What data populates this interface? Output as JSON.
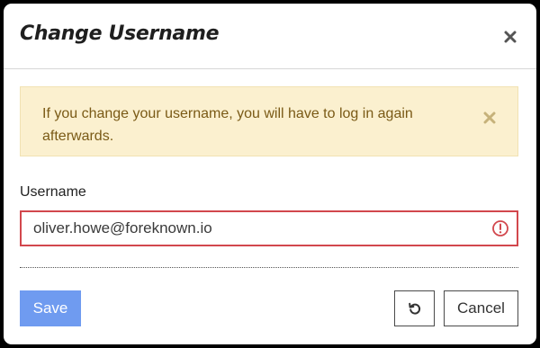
{
  "dialog": {
    "title": "Change Username",
    "close_icon": "close-icon"
  },
  "alert": {
    "message": "If you change your username, you will have to log in again afterwards.",
    "close_icon": "close-icon",
    "background": "#fbf0cf",
    "text_color": "#7a5a16"
  },
  "form": {
    "username_label": "Username",
    "username_value": "oliver.howe@foreknown.io",
    "error_icon": "error-circle-icon",
    "error_color": "#d2474d"
  },
  "footer": {
    "save_label": "Save",
    "reset_icon": "undo-icon",
    "cancel_label": "Cancel",
    "accent": "#6f9bf0"
  }
}
